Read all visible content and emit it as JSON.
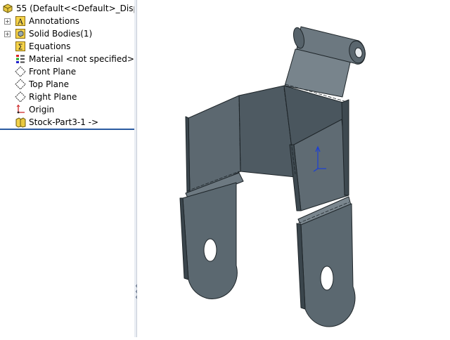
{
  "tree": {
    "root_label": "55  (Default<<Default>_Displ",
    "items": [
      {
        "label": "Annotations"
      },
      {
        "label": "Solid Bodies(1)"
      },
      {
        "label": "Equations"
      },
      {
        "label": "Material <not specified> -"
      },
      {
        "label": "Front Plane"
      },
      {
        "label": "Top Plane"
      },
      {
        "label": "Right Plane"
      },
      {
        "label": "Origin"
      },
      {
        "label": "Stock-Part3-1 ->"
      }
    ]
  },
  "viewport": {
    "part_color": "#5b6870",
    "edge_color": "#1e2529",
    "triad_color": "#1a3fd6"
  }
}
